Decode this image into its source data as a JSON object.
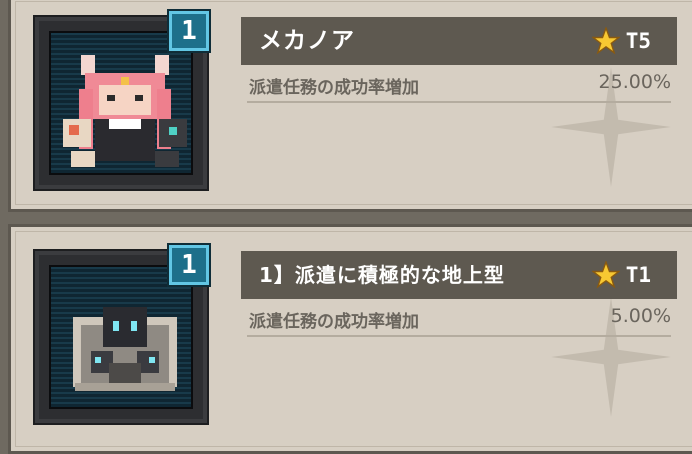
{
  "cards": [
    {
      "level": "1",
      "name": "メカノア",
      "tier": "T5",
      "effect_label": "派遣任務の成功率増加",
      "effect_value": "25.00%"
    },
    {
      "level": "1",
      "name": "1】派遣に積極的な地上型",
      "tier": "T1",
      "effect_label": "派遣任務の成功率増加",
      "effect_value": "5.00%"
    }
  ],
  "icons": {
    "star": "star-icon",
    "character": "pixel-character-sprite",
    "robot": "pixel-robot-sprite"
  },
  "colors": {
    "panel": "#d7cfc3",
    "namebar": "#5e5950",
    "badge": "#1d6f8a",
    "star": "#f7c832"
  }
}
